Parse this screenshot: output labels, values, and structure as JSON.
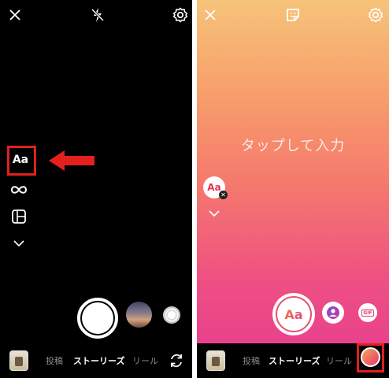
{
  "left": {
    "tools": {
      "text_tool_label": "Aa"
    },
    "modes": {
      "post": "投稿",
      "stories": "ストーリーズ",
      "reels": "リール"
    },
    "icons": [
      "close-icon",
      "flash-off-icon",
      "settings-icon",
      "boomerang-icon",
      "layout-icon",
      "chevron-down-icon",
      "flip-camera-icon"
    ]
  },
  "right": {
    "placeholder": "タップして入力",
    "text_sticker_label": "Aa",
    "create_button_label": "Aa",
    "gif_label": "GIF",
    "modes": {
      "post": "投稿",
      "stories": "ストーリーズ",
      "reels": "リール"
    },
    "icons": [
      "close-icon",
      "sticker-icon",
      "settings-icon",
      "mention-icon",
      "chevron-down-icon"
    ]
  },
  "colors": {
    "highlight": "#e0201f",
    "gradient_top": "#f6c37a",
    "gradient_bottom": "#e63a92"
  }
}
